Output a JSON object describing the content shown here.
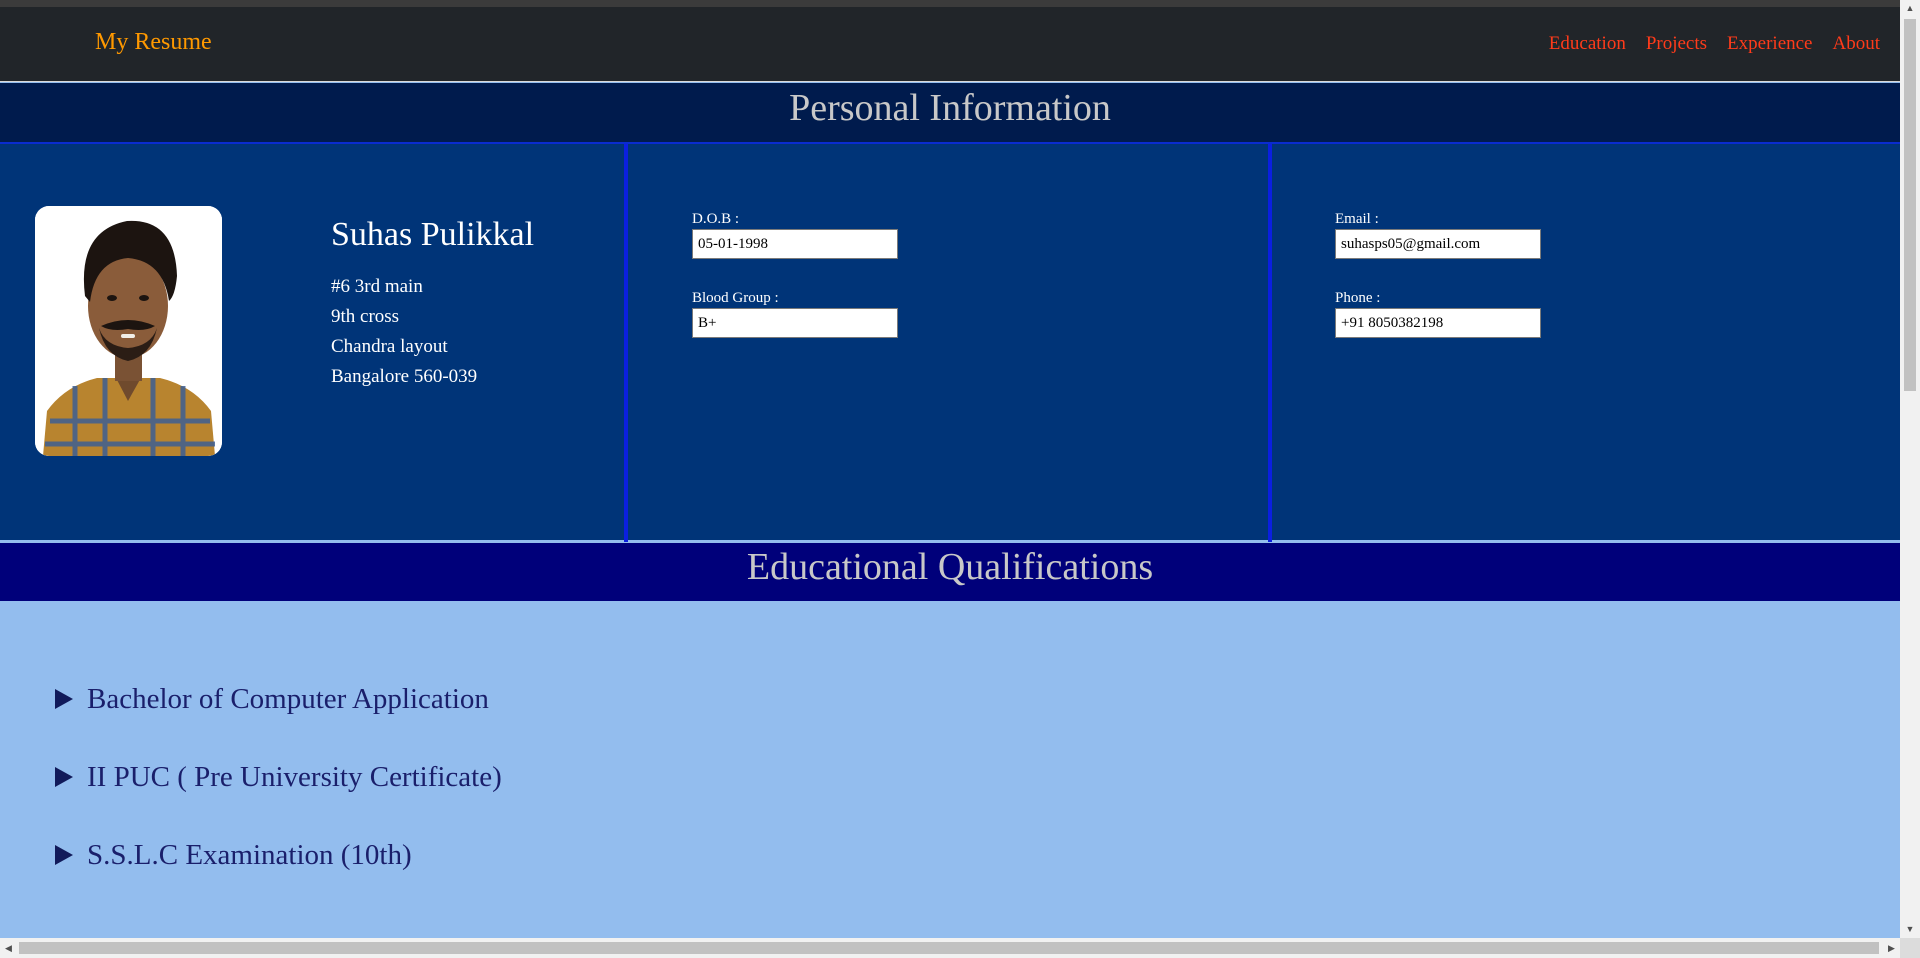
{
  "nav": {
    "brand": "My Resume",
    "links": [
      "Education",
      "Projects",
      "Experience",
      "About"
    ]
  },
  "personal": {
    "heading": "Personal Information",
    "name": "Suhas Pulikkal",
    "address": [
      "#6 3rd main",
      "9th cross",
      "Chandra layout",
      "Bangalore 560-039"
    ],
    "dob_label": "D.O.B :",
    "dob": "05-01-1998",
    "blood_label": "Blood Group :",
    "blood": "B+",
    "email_label": "Email :",
    "email": "suhasps05@gmail.com",
    "phone_label": "Phone :",
    "phone": "+91 8050382198"
  },
  "education": {
    "heading": "Educational Qualifications",
    "items": [
      "Bachelor of Computer Application",
      "II PUC ( Pre University Certificate)",
      "S.S.L.C Examination (10th)"
    ]
  },
  "colors": {
    "navbar_bg": "#212529",
    "brand": "#ff9900",
    "nav_link": "#ff3b1a",
    "personal_header_bg": "#001b4d",
    "personal_bg": "#003478",
    "column_border": "#0b1fe0",
    "edu_header_bg": "#00007a",
    "edu_bg": "#93bdee",
    "edu_text": "#1a1f6b"
  },
  "icons": {
    "profile_photo": "profile-photo",
    "disclosure": "triangle-right-icon"
  }
}
